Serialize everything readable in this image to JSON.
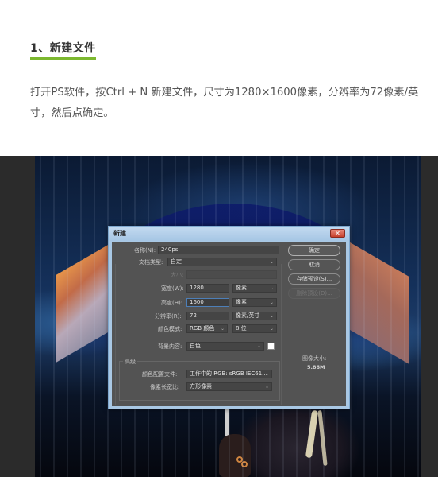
{
  "article": {
    "heading": "1、新建文件",
    "paragraph": "打开PS软件，按Ctrl + N 新建文件，尺寸为1280×1600像素，分辨率为72像素/英寸，然后点确定。",
    "accent_color": "#7cb82f"
  },
  "dialog": {
    "title": "新建",
    "close_glyph": "✕",
    "fields": {
      "name": {
        "label": "名称(N):",
        "value": "240ps"
      },
      "preset": {
        "label": "文档类型:",
        "value": "自定"
      },
      "size": {
        "label": "大小:",
        "value": ""
      },
      "width": {
        "label": "宽度(W):",
        "value": "1280",
        "unit": "像素"
      },
      "height": {
        "label": "高度(H):",
        "value": "1600",
        "unit": "像素"
      },
      "resolution": {
        "label": "分辨率(R):",
        "value": "72",
        "unit": "像素/英寸"
      },
      "color_mode": {
        "label": "颜色模式:",
        "value": "RGB 颜色",
        "depth": "8 位"
      },
      "background": {
        "label": "背景内容:",
        "value": "白色"
      }
    },
    "advanced": {
      "title": "高级",
      "color_profile": {
        "label": "颜色配置文件:",
        "value": "工作中的 RGB: sRGB IEC61..."
      },
      "pixel_aspect": {
        "label": "像素长宽比:",
        "value": "方形像素"
      }
    },
    "buttons": {
      "ok": "确定",
      "cancel": "取消",
      "save_preset": "存储预设(S)...",
      "delete_preset": "删除预设(D)..."
    },
    "image_size": {
      "label": "图像大小:",
      "value": "5.86M"
    }
  }
}
